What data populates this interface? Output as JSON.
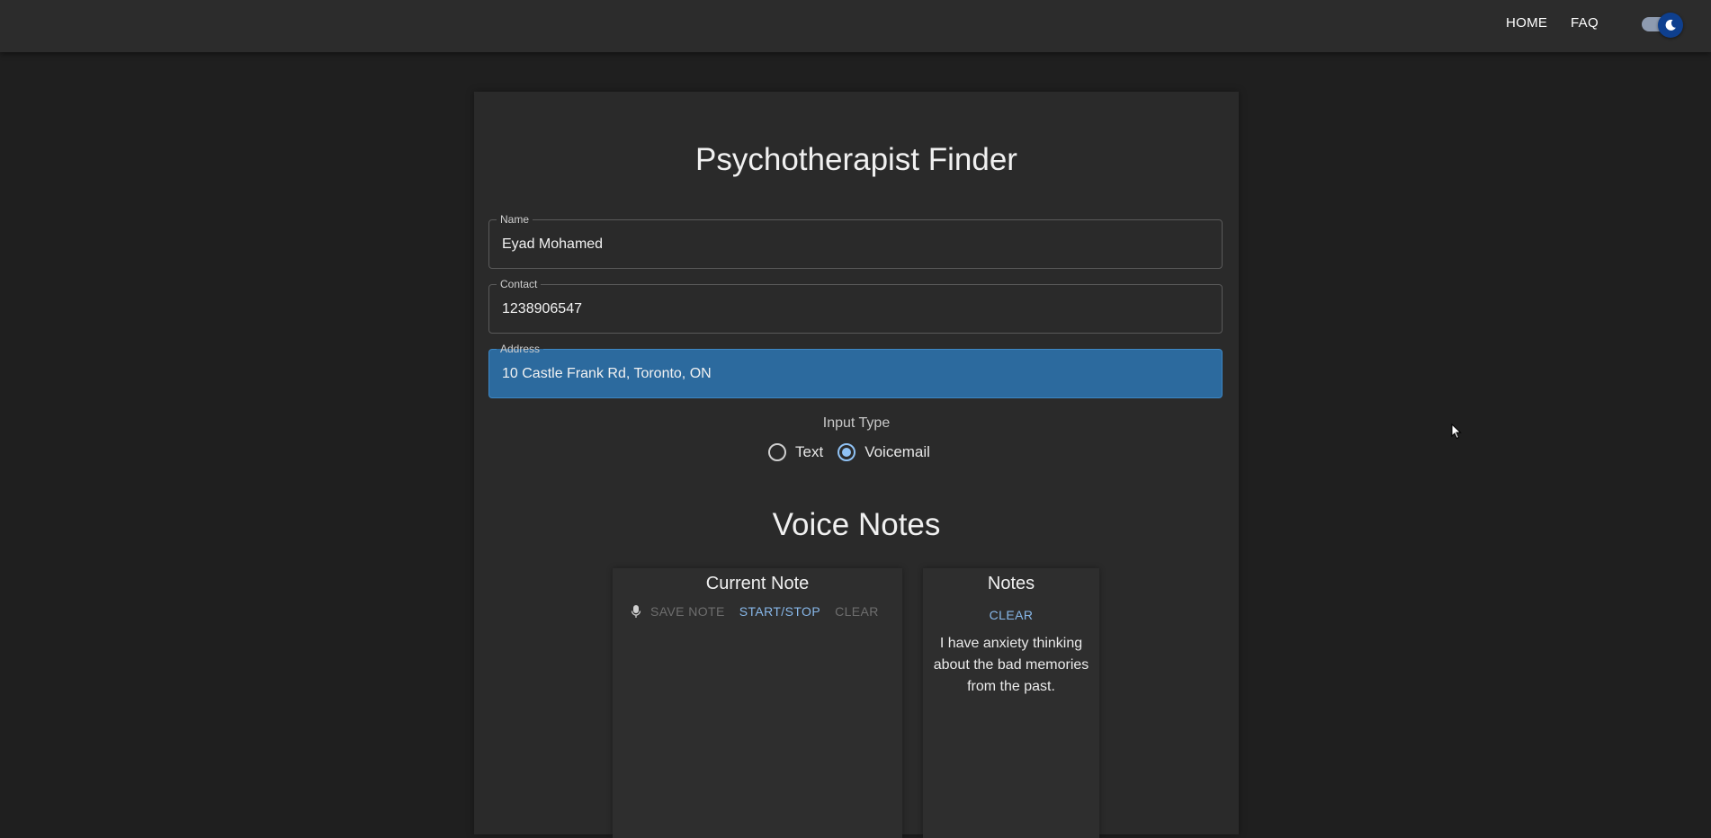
{
  "nav": {
    "home_label": "HOME",
    "faq_label": "FAQ",
    "theme_toggle": {
      "state": "dark",
      "icon": "moon-icon",
      "color": "#0e3f8e"
    }
  },
  "page": {
    "title": "Psychotherapist Finder"
  },
  "form": {
    "name": {
      "label": "Name",
      "value": "Eyad Mohamed"
    },
    "contact": {
      "label": "Contact",
      "value": "1238906547"
    },
    "address": {
      "label": "Address",
      "value": "10 Castle Frank Rd, Toronto, ON",
      "highlight_color": "#2c6a9e"
    },
    "input_type": {
      "label": "Input Type",
      "options": [
        "Text",
        "Voicemail"
      ],
      "selected": "Voicemail"
    }
  },
  "voice_notes": {
    "title": "Voice Notes",
    "current_note": {
      "title": "Current Note",
      "mic_icon": "microphone-icon",
      "save_label": "SAVE NOTE",
      "start_stop_label": "START/STOP",
      "clear_label": "CLEAR"
    },
    "notes": {
      "title": "Notes",
      "clear_label": "CLEAR",
      "items": [
        "I have anxiety thinking about the bad memories from the past."
      ]
    }
  },
  "colors": {
    "background": "#1f1f1f",
    "topbar": "#2c2c2c",
    "card": "#2a2a2a",
    "accent": "#88b8ea"
  }
}
